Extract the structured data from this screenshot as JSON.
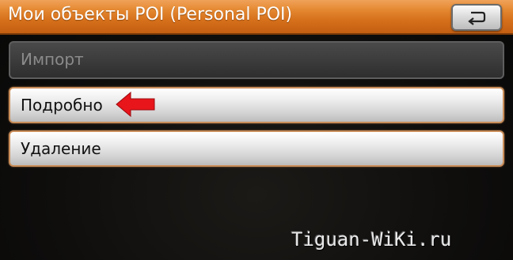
{
  "header": {
    "title": "Мои объекты POI (Personal POI)",
    "back_icon": "return-arrow-icon"
  },
  "menu": {
    "items": [
      {
        "label": "Импорт",
        "enabled": false
      },
      {
        "label": "Подробно",
        "enabled": true
      },
      {
        "label": "Удаление",
        "enabled": true
      }
    ]
  },
  "annotation": {
    "icon": "red-arrow-left-icon",
    "color": "#e8151b"
  },
  "watermark": {
    "text": "Tiguan-WiKi.ru"
  },
  "colors": {
    "header_orange": "#d6701b",
    "button_border": "#c98e5a",
    "background": "#0b0b0b"
  }
}
